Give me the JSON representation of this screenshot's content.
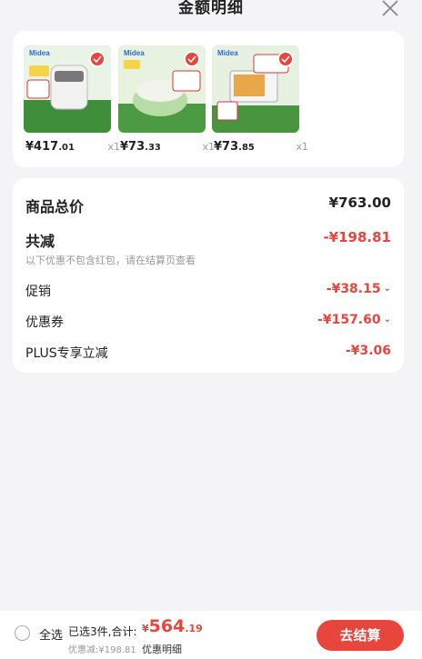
{
  "header": {
    "title": "金额明细"
  },
  "products": [
    {
      "brand": "Midea",
      "price_main": "¥417",
      "price_cents": ".01",
      "qty": "x1"
    },
    {
      "brand": "Midea",
      "price_main": "¥73",
      "price_cents": ".33",
      "qty": "x1"
    },
    {
      "brand": "Midea",
      "price_main": "¥73",
      "price_cents": ".85",
      "qty": "x1"
    }
  ],
  "summary": {
    "total_label": "商品总价",
    "total_value": "¥763.00",
    "reduce_label": "共减",
    "reduce_value": "-¥198.81",
    "note": "以下优惠不包含红包，请在结算页查看",
    "promo_label": "促销",
    "promo_value": "-¥38.15",
    "coupon_label": "优惠券",
    "coupon_value": "-¥157.60",
    "plus_label": "PLUS专享立减",
    "plus_value": "-¥3.06"
  },
  "bottom": {
    "select_all": "全选",
    "selected_text": "已选3件,合计:",
    "total_yen": "¥",
    "total_int": "564",
    "total_dec": ".19",
    "discount_line": "优惠减:¥198.81",
    "detail_link": "优惠明细",
    "checkout": "去结算"
  },
  "colors": {
    "accent": "#e8453c",
    "background": "#f4f4f6"
  }
}
